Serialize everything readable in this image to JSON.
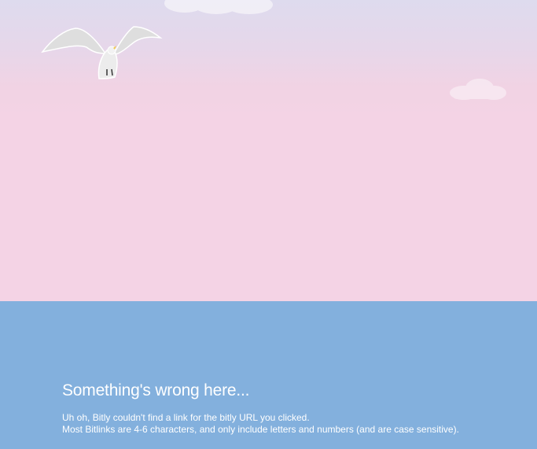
{
  "message": {
    "headline": "Something's wrong here...",
    "line_1": "Uh oh, Bitly couldn't find a link for the bitly URL you clicked.",
    "line_2": "Most Bitlinks are 4-6 characters, and only include letters and numbers (and are case sensitive)."
  },
  "colors": {
    "sky_top": "#dedbee",
    "sky_bottom": "#f4d3e5",
    "sea": "#83b0dd",
    "text": "#ffffff"
  },
  "icons": [
    "seagull-illustration",
    "cloud-illustration"
  ]
}
